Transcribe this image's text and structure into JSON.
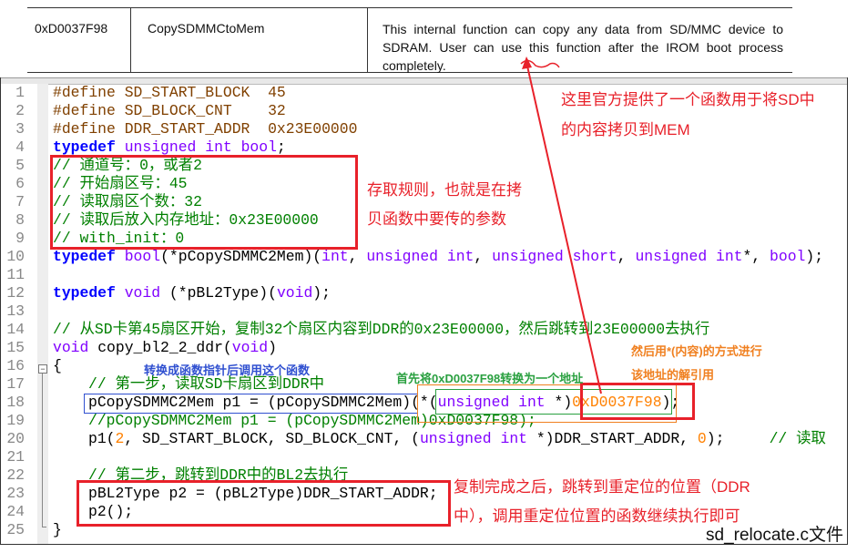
{
  "table_row": {
    "address": "0xD0037F98",
    "function_name": "CopySDMMCtoMem",
    "description": "This internal function can copy any data from SD/MMC device to SDRAM. User can use this function after the IROM boot process completely."
  },
  "editor": {
    "line_numbers": [
      "1",
      "2",
      "3",
      "4",
      "5",
      "6",
      "7",
      "8",
      "9",
      "10",
      "11",
      "12",
      "13",
      "14",
      "15",
      "16",
      "17",
      "18",
      "19",
      "20",
      "21",
      "22",
      "23",
      "24",
      "25"
    ],
    "lines": [
      {
        "indent": 0,
        "tokens": [
          {
            "t": "#define SD_START_BLOCK  45",
            "c": "pp"
          }
        ]
      },
      {
        "indent": 0,
        "tokens": [
          {
            "t": "#define SD_BLOCK_CNT    32",
            "c": "pp"
          }
        ]
      },
      {
        "indent": 0,
        "tokens": [
          {
            "t": "#define DDR_START_ADDR  0x23E00000",
            "c": "pp"
          }
        ]
      },
      {
        "indent": 0,
        "tokens": [
          {
            "t": "typedef",
            "c": "kw"
          },
          {
            "t": " ",
            "c": "df"
          },
          {
            "t": "unsigned int bool",
            "c": "ty"
          },
          {
            "t": ";",
            "c": "df"
          }
        ]
      },
      {
        "indent": 0,
        "tokens": [
          {
            "t": "// 通道号：0，或者2",
            "c": "cm"
          }
        ]
      },
      {
        "indent": 0,
        "tokens": [
          {
            "t": "// 开始扇区号：45",
            "c": "cm"
          }
        ]
      },
      {
        "indent": 0,
        "tokens": [
          {
            "t": "// 读取扇区个数：32",
            "c": "cm"
          }
        ]
      },
      {
        "indent": 0,
        "tokens": [
          {
            "t": "// 读取后放入内存地址：0x23E00000",
            "c": "cm"
          }
        ]
      },
      {
        "indent": 0,
        "tokens": [
          {
            "t": "// with_init：0",
            "c": "cm"
          }
        ]
      },
      {
        "indent": 0,
        "tokens": [
          {
            "t": "typedef",
            "c": "kw"
          },
          {
            "t": " ",
            "c": "df"
          },
          {
            "t": "bool",
            "c": "ty"
          },
          {
            "t": "(*pCopySDMMC2Mem)(",
            "c": "df"
          },
          {
            "t": "int",
            "c": "ty"
          },
          {
            "t": ", ",
            "c": "df"
          },
          {
            "t": "unsigned int",
            "c": "ty"
          },
          {
            "t": ", ",
            "c": "df"
          },
          {
            "t": "unsigned short",
            "c": "ty"
          },
          {
            "t": ", ",
            "c": "df"
          },
          {
            "t": "unsigned int",
            "c": "ty"
          },
          {
            "t": "*, ",
            "c": "df"
          },
          {
            "t": "bool",
            "c": "ty"
          },
          {
            "t": ");",
            "c": "df"
          }
        ]
      },
      {
        "indent": 0,
        "tokens": []
      },
      {
        "indent": 0,
        "tokens": [
          {
            "t": "typedef",
            "c": "kw"
          },
          {
            "t": " ",
            "c": "df"
          },
          {
            "t": "void",
            "c": "ty"
          },
          {
            "t": " (*pBL2Type)(",
            "c": "df"
          },
          {
            "t": "void",
            "c": "ty"
          },
          {
            "t": ");",
            "c": "df"
          }
        ]
      },
      {
        "indent": 0,
        "tokens": []
      },
      {
        "indent": 0,
        "tokens": [
          {
            "t": "// 从SD卡第45扇区开始，复制32个扇区内容到DDR的0x23E00000，然后跳转到23E00000去执行",
            "c": "cm"
          }
        ]
      },
      {
        "indent": 0,
        "tokens": [
          {
            "t": "void",
            "c": "ty"
          },
          {
            "t": " copy_bl2_2_ddr(",
            "c": "df"
          },
          {
            "t": "void",
            "c": "ty"
          },
          {
            "t": ")",
            "c": "df"
          }
        ]
      },
      {
        "indent": 0,
        "tokens": [
          {
            "t": "{",
            "c": "df"
          }
        ]
      },
      {
        "indent": 1,
        "tokens": [
          {
            "t": "// 第一步，读取SD卡扇区到DDR中",
            "c": "cm"
          }
        ]
      },
      {
        "indent": 1,
        "tokens": [
          {
            "t": "pCopySDMMC2Mem p1 = (pCopySDMMC2Mem)(*(",
            "c": "df"
          },
          {
            "t": "unsigned int",
            "c": "ty"
          },
          {
            "t": " *)",
            "c": "df"
          },
          {
            "t": "0xD0037F98",
            "c": "nu"
          },
          {
            "t": ");",
            "c": "df"
          }
        ]
      },
      {
        "indent": 1,
        "tokens": [
          {
            "t": "//pCopySDMMC2Mem p1 = (pCopySDMMC2Mem)0xD0037F98);",
            "c": "cm"
          }
        ]
      },
      {
        "indent": 1,
        "tokens": [
          {
            "t": "p1(",
            "c": "df"
          },
          {
            "t": "2",
            "c": "nu"
          },
          {
            "t": ", SD_START_BLOCK, SD_BLOCK_CNT, (",
            "c": "df"
          },
          {
            "t": "unsigned int",
            "c": "ty"
          },
          {
            "t": " *)DDR_START_ADDR, ",
            "c": "df"
          },
          {
            "t": "0",
            "c": "nu"
          },
          {
            "t": ");     ",
            "c": "df"
          },
          {
            "t": "// 读取",
            "c": "cm"
          }
        ]
      },
      {
        "indent": 0,
        "tokens": []
      },
      {
        "indent": 1,
        "tokens": [
          {
            "t": "// 第二步，跳转到DDR中的BL2去执行",
            "c": "cm"
          }
        ]
      },
      {
        "indent": 1,
        "tokens": [
          {
            "t": "pBL2Type p2 = (pBL2Type)DDR_START_ADDR;",
            "c": "df"
          }
        ]
      },
      {
        "indent": 1,
        "tokens": [
          {
            "t": "p2();",
            "c": "df"
          }
        ]
      },
      {
        "indent": 0,
        "tokens": [
          {
            "t": "}",
            "c": "df"
          }
        ]
      }
    ]
  },
  "annotations": {
    "official_function_line1": "这里官方提供了一个函数用于将SD中",
    "official_function_line2": "的内容拷贝到MEM",
    "access_rules_line1": "存取规则，也就是在拷",
    "access_rules_line2": "贝函数中要传的参数",
    "convert_pointer": "转换成函数指针后调用这个函数",
    "convert_address": "首先将0xD0037F98转换为一个地址",
    "dereference_line1": "然后用*(内容)的方式进行",
    "dereference_line2": "该地址的解引用",
    "jump_line1": "复制完成之后，跳转到重定位的位置（DDR",
    "jump_line2": "中），调用重定位位置的函数继续执行即可",
    "file_label": "sd_relocate.c文件"
  },
  "colors": {
    "annotation_red": "#e8212a",
    "annotation_blue": "#3050d0",
    "annotation_green": "#2aa040",
    "annotation_orange": "#f08020"
  }
}
